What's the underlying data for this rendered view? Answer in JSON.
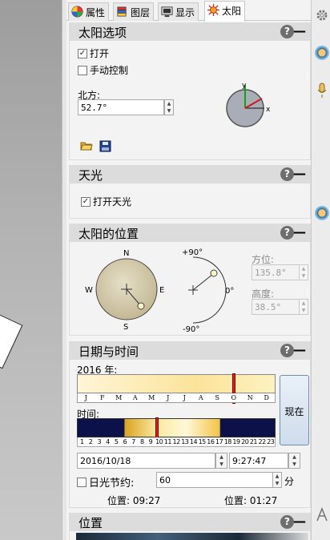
{
  "tabs": [
    {
      "label": "属性",
      "icon": "properties-icon"
    },
    {
      "label": "图层",
      "icon": "layers-icon"
    },
    {
      "label": "显示",
      "icon": "display-icon"
    },
    {
      "label": "太阳",
      "icon": "sun-icon",
      "active": true
    }
  ],
  "sun_options": {
    "title": "太阳选项",
    "help": "?",
    "collapse": "—",
    "enable_label": "打开",
    "enable_checked": true,
    "manual_label": "手动控制",
    "manual_checked": false,
    "north_label": "北方:",
    "north_value": "52.7°",
    "axis_y": "y",
    "axis_x": "x"
  },
  "skylight": {
    "title": "天光",
    "help": "?",
    "collapse": "—",
    "enable_label": "打开天光",
    "enable_checked": true
  },
  "sun_position": {
    "title": "太阳的位置",
    "help": "?",
    "collapse": "—",
    "compass": {
      "n": "N",
      "w": "W",
      "e": "E",
      "s": "S"
    },
    "altitude_marks": {
      "top": "+90°",
      "mid": "0°",
      "bottom": "-90°"
    },
    "azimuth_label": "方位:",
    "azimuth_value": "135.8°",
    "altitude_label": "高度:",
    "altitude_value": "38.5°"
  },
  "date_time": {
    "title": "日期与时间",
    "help": "?",
    "collapse": "—",
    "year_label": "2016 年:",
    "month_letters": [
      "J",
      "F",
      "M",
      "A",
      "M",
      "J",
      "J",
      "A",
      "S",
      "O",
      "N",
      "D"
    ],
    "time_label": "时间:",
    "hours": [
      "1",
      "2",
      "3",
      "4",
      "5",
      "6",
      "7",
      "8",
      "9",
      "10",
      "11",
      "12",
      "13",
      "14",
      "15",
      "16",
      "17",
      "18",
      "19",
      "20",
      "21",
      "22",
      "23"
    ],
    "year_marker_fraction": 0.79,
    "day_marker_fraction": 0.405,
    "now_button": "现在",
    "date_value": "2016/10/18",
    "time_value": "9:27:47",
    "dst_label": "日光节约:",
    "dst_checked": false,
    "dst_value": "60",
    "dst_unit": "分",
    "position_left": "位置: 09:27",
    "position_right": "位置: 01:27"
  },
  "location": {
    "title": "位置",
    "help": "?",
    "collapse": "—"
  },
  "colors": {
    "section_header": "#dcdcdc",
    "marker_red": "#e02020",
    "night_blue": "#0d1149",
    "sun_gold": "#fbe39a"
  }
}
